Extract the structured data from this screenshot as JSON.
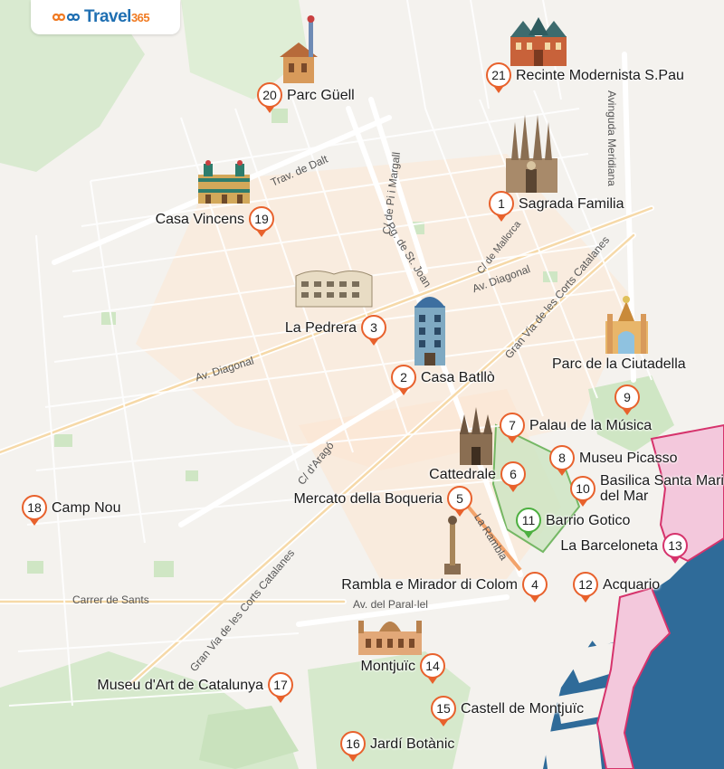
{
  "brand": {
    "name": "Travel",
    "number": "365",
    "primary_color": "#1f6fb2",
    "accent_color": "#f07a22"
  },
  "colors": {
    "pin_default": "#e8612c",
    "pin_park": "#4caf3f",
    "pin_beach": "#d6336c",
    "sea": "#2f6b99",
    "park": "#cfe6c4",
    "beach_zone": "#f3c8dc"
  },
  "streets": [
    {
      "id": "trav-de-dalt",
      "label": "Trav. de Dalt"
    },
    {
      "id": "c-pi-margall",
      "label": "C/ de Pi i Margall"
    },
    {
      "id": "avinguda-meridiana",
      "label": "Avinguda Meridiana"
    },
    {
      "id": "pg-st-joan",
      "label": "Pg. de St. Joan"
    },
    {
      "id": "c-mallorca",
      "label": "C/ de Mallorca"
    },
    {
      "id": "av-diagonal-east",
      "label": "Av. Diagonal"
    },
    {
      "id": "gran-via-north",
      "label": "Gran Via de les Corts Catalanes"
    },
    {
      "id": "av-diagonal-west",
      "label": "Av. Diagonal"
    },
    {
      "id": "c-arago",
      "label": "C/ d'Aragó"
    },
    {
      "id": "la-rambla",
      "label": "La Rambla"
    },
    {
      "id": "carrer-de-sants",
      "label": "Carrer de Sants"
    },
    {
      "id": "gran-via-south",
      "label": "Gran Via de les Corts Catalanes"
    },
    {
      "id": "av-paral-lel",
      "label": "Av. del Paral·lel"
    }
  ],
  "pois": [
    {
      "num": "1",
      "label": "Sagrada Familia"
    },
    {
      "num": "2",
      "label": "Casa Batllò"
    },
    {
      "num": "3",
      "label": "La Pedrera"
    },
    {
      "num": "4",
      "label": "Rambla e Mirador di Colom"
    },
    {
      "num": "5",
      "label": "Mercato della Boqueria"
    },
    {
      "num": "6",
      "label": "Cattedrale"
    },
    {
      "num": "7",
      "label": "Palau de la Música"
    },
    {
      "num": "8",
      "label": "Museu Picasso"
    },
    {
      "num": "9",
      "label": "Parc de la Ciutadella"
    },
    {
      "num": "10",
      "label": "Basilica Santa Maria del Mar"
    },
    {
      "num": "11",
      "label": "Barrio Gotico"
    },
    {
      "num": "12",
      "label": "Acquario"
    },
    {
      "num": "13",
      "label": "La Barceloneta"
    },
    {
      "num": "14",
      "label": "Montjuïc"
    },
    {
      "num": "15",
      "label": "Castell de Montjuïc"
    },
    {
      "num": "16",
      "label": "Jardí Botànic"
    },
    {
      "num": "17",
      "label": "Museu d'Art de Catalunya"
    },
    {
      "num": "18",
      "label": "Camp Nou"
    },
    {
      "num": "19",
      "label": "Casa Vincens"
    },
    {
      "num": "20",
      "label": "Parc Güell"
    },
    {
      "num": "21",
      "label": "Recinte Modernista S.Pau"
    }
  ],
  "monuments": [
    {
      "id": "parc-guell",
      "icon": "parc-guell-illustration"
    },
    {
      "id": "sant-pau",
      "icon": "sant-pau-illustration"
    },
    {
      "id": "casa-vicens",
      "icon": "casa-vicens-illustration"
    },
    {
      "id": "sagrada-familia",
      "icon": "sagrada-familia-illustration"
    },
    {
      "id": "la-pedrera",
      "icon": "la-pedrera-illustration"
    },
    {
      "id": "casa-batllo",
      "icon": "casa-batllo-illustration"
    },
    {
      "id": "ciutadella",
      "icon": "ciutadella-illustration"
    },
    {
      "id": "cathedral",
      "icon": "cathedral-illustration"
    },
    {
      "id": "columbus",
      "icon": "columbus-monument-illustration"
    },
    {
      "id": "mnac",
      "icon": "mnac-illustration"
    }
  ]
}
